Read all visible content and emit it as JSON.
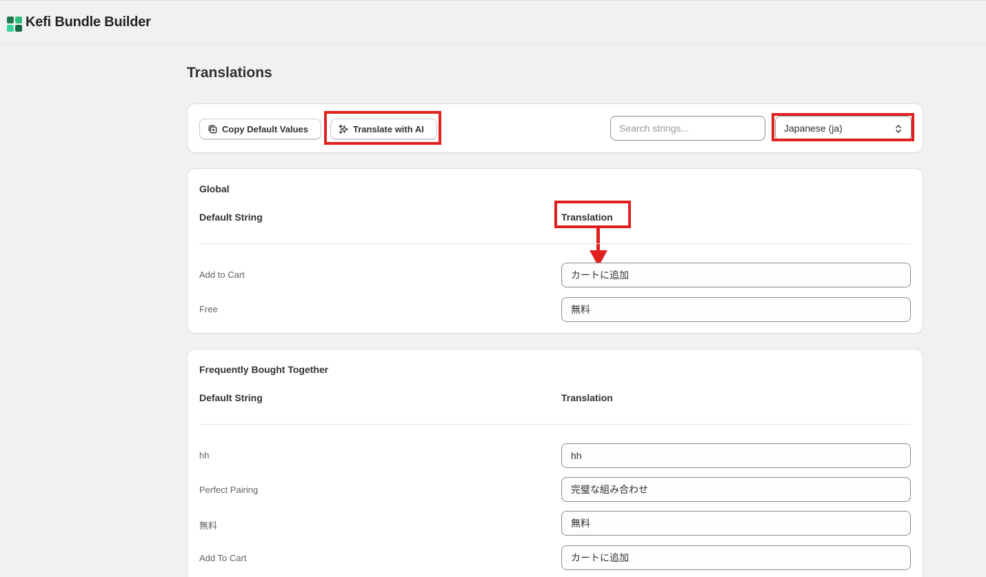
{
  "app": {
    "title": "Kefi Bundle Builder",
    "logo_icon": "kefi-logo-icon"
  },
  "page": {
    "title": "Translations"
  },
  "toolbar": {
    "copy_label": "Copy Default Values",
    "ai_label": "Translate with AI",
    "search_placeholder": "Search strings...",
    "language_selected": "Japanese (ja)"
  },
  "sections": [
    {
      "title": "Global",
      "col_default": "Default String",
      "col_translation": "Translation",
      "rows": [
        {
          "default": "Add to Cart",
          "translation": "カートに追加"
        },
        {
          "default": "Free",
          "translation": "無料"
        }
      ]
    },
    {
      "title": "Frequently Bought Together",
      "col_default": "Default String",
      "col_translation": "Translation",
      "rows": [
        {
          "default": "hh",
          "translation": "hh"
        },
        {
          "default": "Perfect Pairing",
          "translation": "完璧な組み合わせ"
        },
        {
          "default": "無料",
          "translation": "無料"
        },
        {
          "default": "Add To Cart",
          "translation": "カートに追加"
        }
      ]
    }
  ],
  "colors": {
    "highlight": "#e0201f",
    "brand_green": "#1e9e6a"
  }
}
